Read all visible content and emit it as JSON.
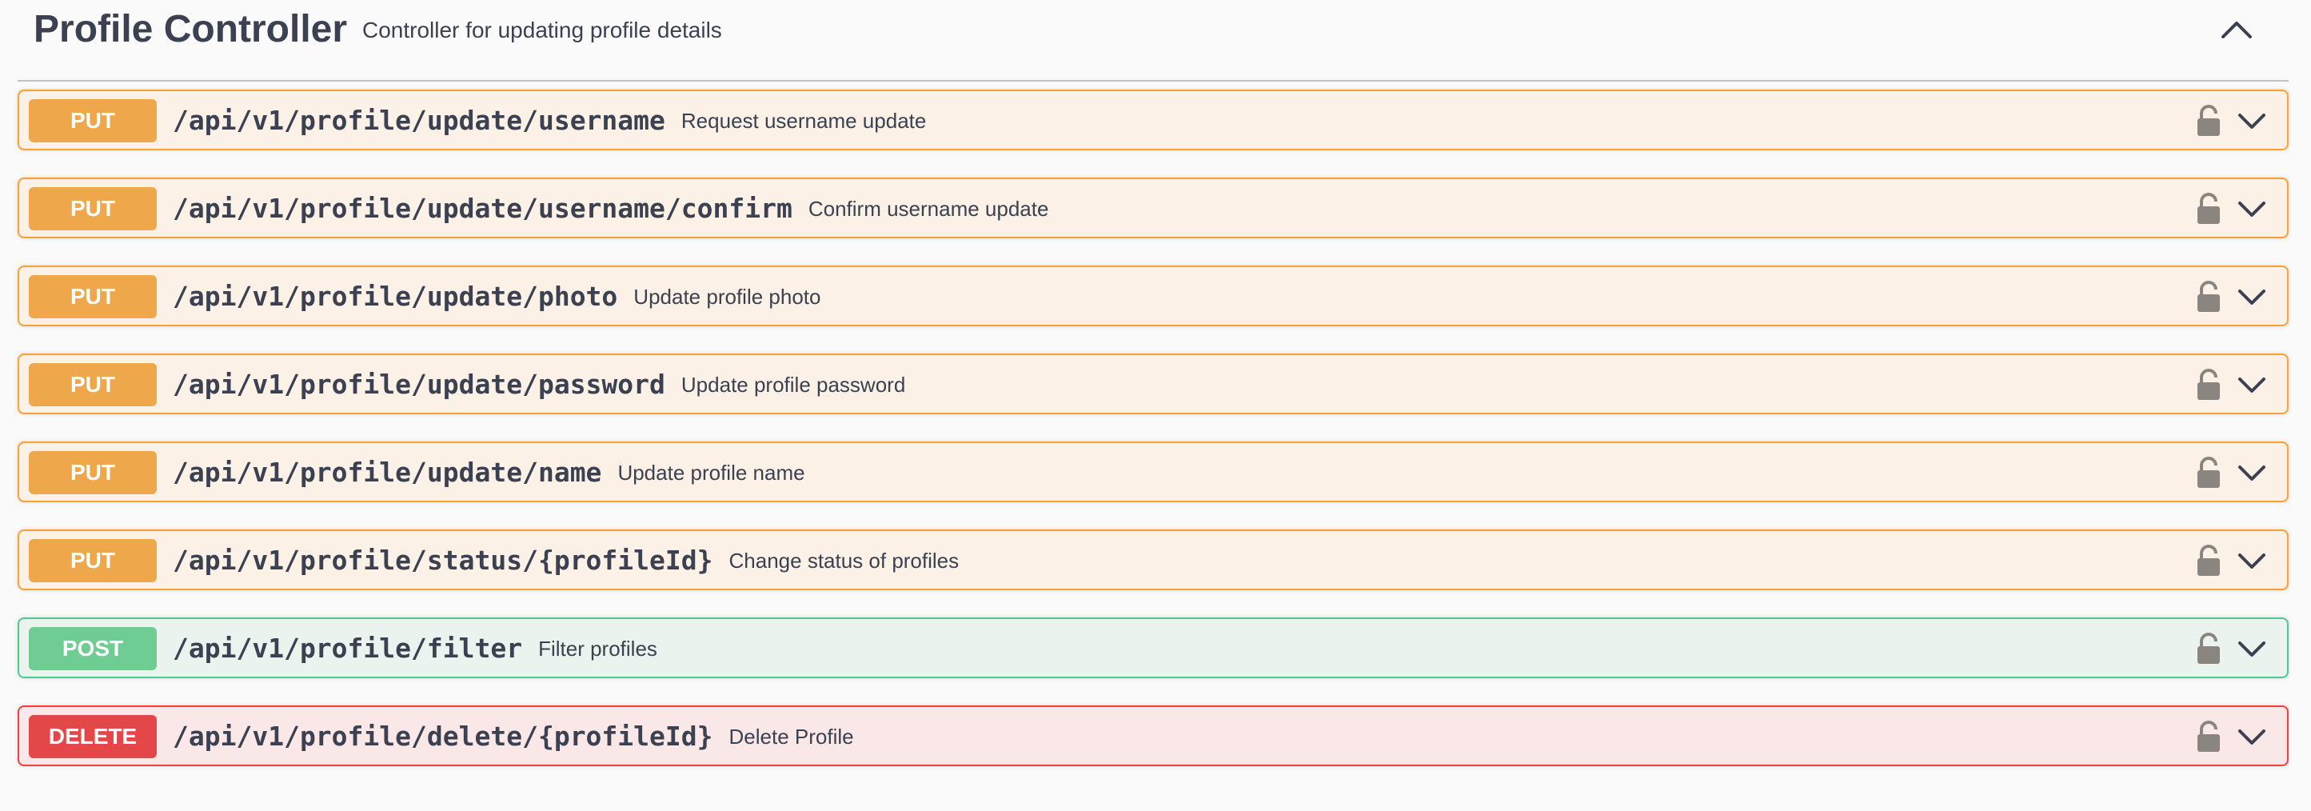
{
  "section": {
    "title": "Profile Controller",
    "description": "Controller for updating profile details",
    "toggle_icon": "chevron-up-icon"
  },
  "operations": [
    {
      "method": "PUT",
      "path": "/api/v1/profile/update/username",
      "summary": "Request username update"
    },
    {
      "method": "PUT",
      "path": "/api/v1/profile/update/username/confirm",
      "summary": "Confirm username update"
    },
    {
      "method": "PUT",
      "path": "/api/v1/profile/update/photo",
      "summary": "Update profile photo"
    },
    {
      "method": "PUT",
      "path": "/api/v1/profile/update/password",
      "summary": "Update profile password"
    },
    {
      "method": "PUT",
      "path": "/api/v1/profile/update/name",
      "summary": "Update profile name"
    },
    {
      "method": "PUT",
      "path": "/api/v1/profile/status/{profileId}",
      "summary": "Change status of profiles"
    },
    {
      "method": "POST",
      "path": "/api/v1/profile/filter",
      "summary": "Filter profiles"
    },
    {
      "method": "DELETE",
      "path": "/api/v1/profile/delete/{profileId}",
      "summary": "Delete Profile"
    }
  ],
  "icons": {
    "lock": "lock-icon",
    "expand": "chevron-down-icon"
  },
  "colors": {
    "put": "#fca130",
    "post": "#49cc90",
    "delete": "#f93e3e",
    "text": "#3b4151",
    "icon_gray": "#8a857f"
  }
}
